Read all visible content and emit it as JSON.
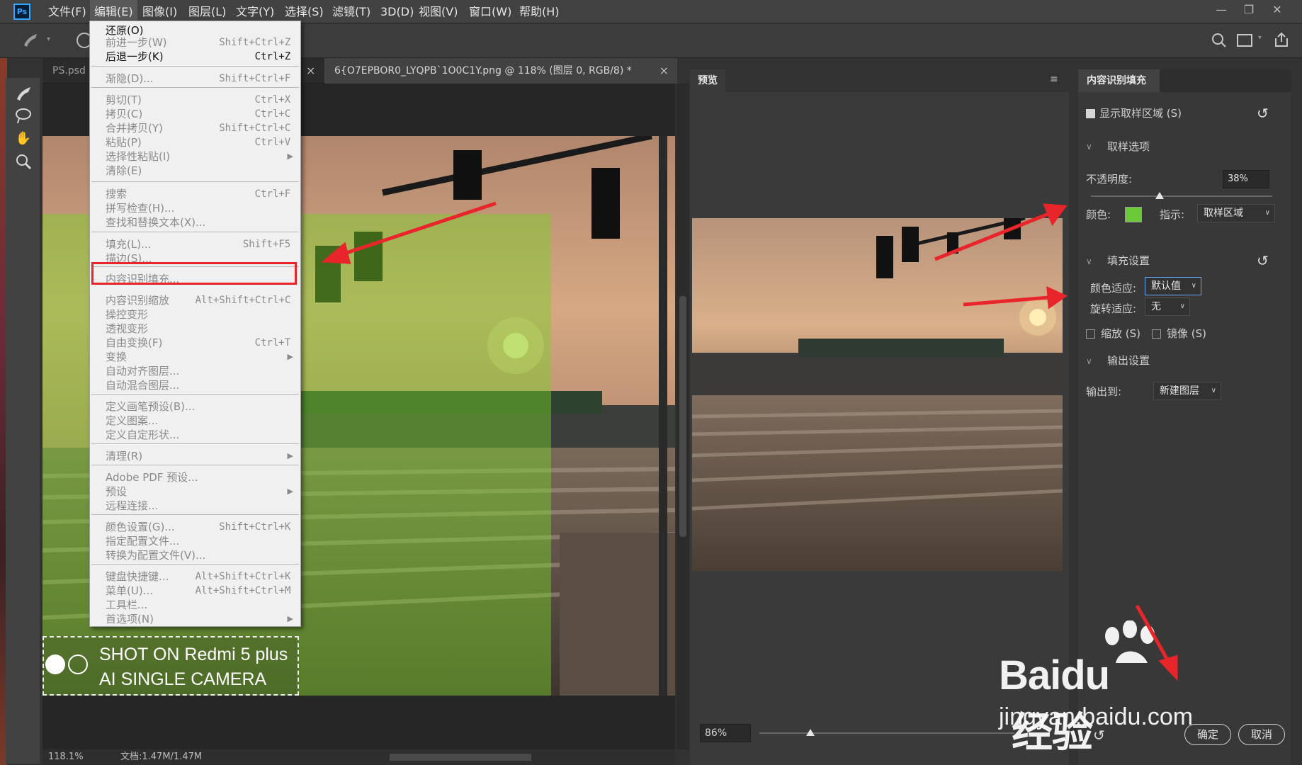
{
  "app": {
    "logo": "Ps"
  },
  "menubar": {
    "items": [
      "文件(F)",
      "编辑(E)",
      "图像(I)",
      "图层(L)",
      "文字(Y)",
      "选择(S)",
      "滤镜(T)",
      "3D(D)",
      "视图(V)",
      "窗口(W)",
      "帮助(H)"
    ],
    "active": "编辑(E)"
  },
  "window_controls": {
    "minimize": "—",
    "restore": "❐",
    "close": "✕"
  },
  "tabs": [
    {
      "label": "PS.psd",
      "close": "×"
    },
    {
      "label": "6{O7EPBOR0_LYQPB`1O0C1Y.png  @  118%  (图层 0, RGB/8) *",
      "close": "×"
    }
  ],
  "canvas": {
    "watermark_line1": "SHOT ON Redmi 5 plus",
    "watermark_line2": "AI SINGLE CAMERA"
  },
  "statusbar": {
    "zoom": "118.1%",
    "doc": "文档:1.47M/1.47M"
  },
  "edit_menu": {
    "items": [
      {
        "label": "还原(O)",
        "shortcut": "",
        "enabled": true
      },
      {
        "label": "前进一步(W)",
        "shortcut": "Shift+Ctrl+Z",
        "enabled": false
      },
      {
        "label": "后退一步(K)",
        "shortcut": "Ctrl+Z",
        "enabled": true
      },
      {
        "label": "渐隐(D)...",
        "shortcut": "Shift+Ctrl+F",
        "enabled": false
      },
      {
        "label": "剪切(T)",
        "shortcut": "Ctrl+X",
        "enabled": false
      },
      {
        "label": "拷贝(C)",
        "shortcut": "Ctrl+C",
        "enabled": false
      },
      {
        "label": "合并拷贝(Y)",
        "shortcut": "Shift+Ctrl+C",
        "enabled": false
      },
      {
        "label": "粘贴(P)",
        "shortcut": "Ctrl+V",
        "enabled": false
      },
      {
        "label": "选择性粘贴(I)",
        "shortcut": "",
        "enabled": false,
        "submenu": true
      },
      {
        "label": "清除(E)",
        "shortcut": "",
        "enabled": false
      },
      {
        "label": "搜索",
        "shortcut": "Ctrl+F",
        "enabled": false
      },
      {
        "label": "拼写检查(H)...",
        "shortcut": "",
        "enabled": false
      },
      {
        "label": "查找和替换文本(X)...",
        "shortcut": "",
        "enabled": false
      },
      {
        "label": "填充(L)...",
        "shortcut": "Shift+F5",
        "enabled": false
      },
      {
        "label": "描边(S)...",
        "shortcut": "",
        "enabled": false
      },
      {
        "label": "内容识别填充...",
        "shortcut": "",
        "enabled": false,
        "highlighted": true
      },
      {
        "label": "内容识别缩放",
        "shortcut": "Alt+Shift+Ctrl+C",
        "enabled": false
      },
      {
        "label": "操控变形",
        "shortcut": "",
        "enabled": false
      },
      {
        "label": "透视变形",
        "shortcut": "",
        "enabled": false
      },
      {
        "label": "自由变换(F)",
        "shortcut": "Ctrl+T",
        "enabled": false
      },
      {
        "label": "变换",
        "shortcut": "",
        "enabled": false,
        "submenu": true
      },
      {
        "label": "自动对齐图层...",
        "shortcut": "",
        "enabled": false
      },
      {
        "label": "自动混合图层...",
        "shortcut": "",
        "enabled": false
      },
      {
        "label": "定义画笔预设(B)...",
        "shortcut": "",
        "enabled": false
      },
      {
        "label": "定义图案...",
        "shortcut": "",
        "enabled": false
      },
      {
        "label": "定义自定形状...",
        "shortcut": "",
        "enabled": false
      },
      {
        "label": "清理(R)",
        "shortcut": "",
        "enabled": false,
        "submenu": true
      },
      {
        "label": "Adobe PDF 预设...",
        "shortcut": "",
        "enabled": false
      },
      {
        "label": "预设",
        "shortcut": "",
        "enabled": false,
        "submenu": true
      },
      {
        "label": "远程连接...",
        "shortcut": "",
        "enabled": false
      },
      {
        "label": "颜色设置(G)...",
        "shortcut": "Shift+Ctrl+K",
        "enabled": false
      },
      {
        "label": "指定配置文件...",
        "shortcut": "",
        "enabled": false
      },
      {
        "label": "转换为配置文件(V)...",
        "shortcut": "",
        "enabled": false
      },
      {
        "label": "键盘快捷键...",
        "shortcut": "Alt+Shift+Ctrl+K",
        "enabled": false
      },
      {
        "label": "菜单(U)...",
        "shortcut": "Alt+Shift+Ctrl+M",
        "enabled": false
      },
      {
        "label": "工具栏...",
        "shortcut": "",
        "enabled": false
      },
      {
        "label": "首选项(N)",
        "shortcut": "",
        "enabled": false,
        "submenu": true
      }
    ]
  },
  "preview": {
    "title": "预览",
    "zoom": "86%"
  },
  "caf_panel": {
    "title": "内容识别填充",
    "show_sampling": "显示取样区域 (S)",
    "sampling_section": "取样选项",
    "opacity_label": "不透明度:",
    "opacity_value": "38%",
    "opacity_fraction": 0.38,
    "color_label": "颜色:",
    "color_swatch": "#6cc93a",
    "indicate_label": "指示:",
    "indicate_value": "取样区域",
    "fill_section": "填充设置",
    "color_adapt_label": "颜色适应:",
    "color_adapt_value": "默认值",
    "rotate_adapt_label": "旋转适应:",
    "rotate_adapt_value": "无",
    "scale_label": "缩放 (S)",
    "mirror_label": "镜像 (S)",
    "output_section": "输出设置",
    "output_label": "输出到:",
    "output_value": "新建图层",
    "ok": "确定",
    "cancel": "取消"
  },
  "watermark": {
    "brand": "Baidu",
    "brand_cn": "经验",
    "url": "jingyan.baidu.com"
  }
}
